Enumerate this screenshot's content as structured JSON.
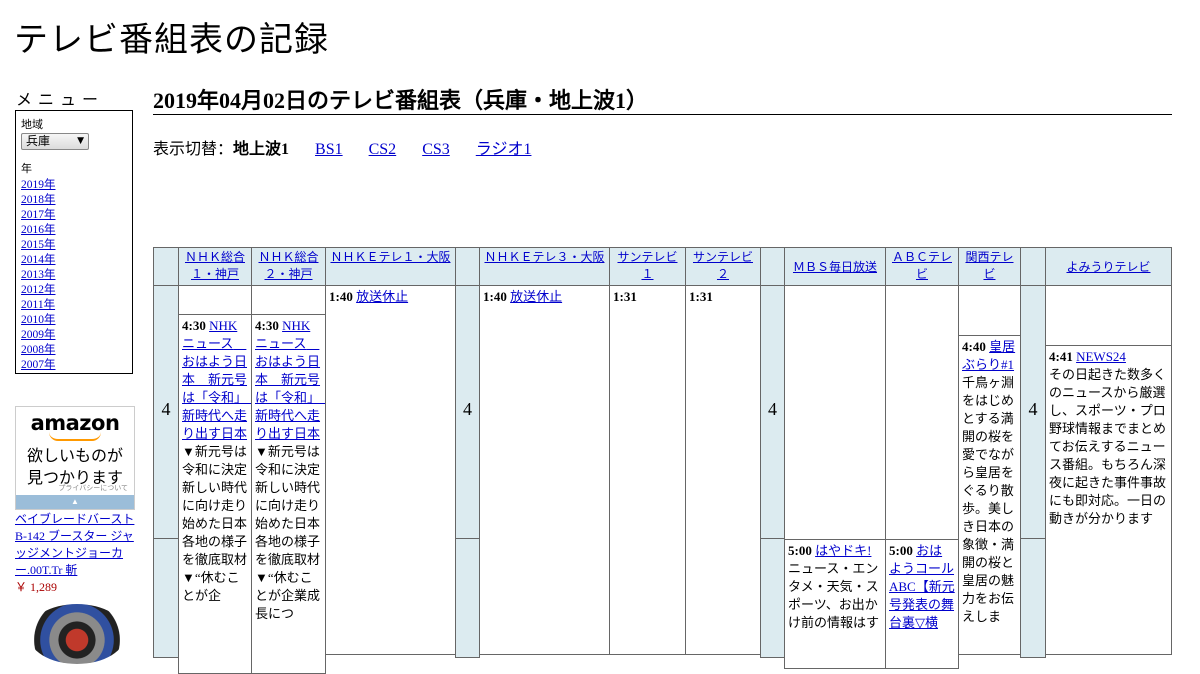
{
  "site": {
    "title": "テレビ番組表の記録"
  },
  "menu": {
    "heading": "メニュー",
    "region_label": "地域",
    "region_value": "兵庫",
    "year_label": "年",
    "years": [
      "2019年",
      "2018年",
      "2017年",
      "2016年",
      "2015年",
      "2014年",
      "2013年",
      "2012年",
      "2011年",
      "2010年",
      "2009年",
      "2008年",
      "2007年"
    ]
  },
  "ad": {
    "logo": "amazon",
    "line1": "欲しいものが",
    "line2": "見つかります",
    "privacy": "プライバシーについて",
    "product_name": "ベイブレードバースト B-142 ブースター ジャッジメントジョーカー.00T.Tr 斬",
    "product_price": "￥ 1,289"
  },
  "main": {
    "heading": "2019年04月02日のテレビ番組表（兵庫・地上波1）",
    "switch_label": "表示切替：",
    "switch_current": "地上波1",
    "switch_links": [
      "BS1",
      "CS2",
      "CS3",
      "ラジオ1"
    ]
  },
  "channels": [
    "ＮＨＫ総合１・神戸",
    "ＮＨＫ総合２・神戸",
    "ＮＨＫＥテレ１・大阪",
    "ＮＨＫＥテレ３・大阪",
    "サンテレビ１",
    "サンテレビ２",
    "ＭＢＳ毎日放送",
    "ＡＢＣテレビ",
    "関西テレビ",
    "よみうりテレビ"
  ],
  "hour": "4",
  "programs": {
    "nhk1": {
      "time": "4:30",
      "title": "NHKニュース　おはよう日本　新元号は「令和」　新時代へ走り出す日本",
      "desc": "▼新元号は令和に決定　新しい時代に向け走り始めた日本各地の様子を徹底取材▼“休むことが企"
    },
    "nhk2": {
      "time": "4:30",
      "title": "NHKニュース　おはよう日本　新元号は「令和」　新時代へ走り出す日本",
      "desc": "▼新元号は令和に決定　新しい時代に向け走り始めた日本各地の様子を徹底取材▼“休むことが企業成長につ"
    },
    "etv1": {
      "time": "1:40",
      "title": "放送休止"
    },
    "etv3": {
      "time": "1:40",
      "title": "放送休止"
    },
    "sun1": {
      "time": "1:31"
    },
    "sun2": {
      "time": "1:31"
    },
    "mbs": {
      "time": "5:00",
      "title": "はやドキ!",
      "desc": "ニュース・エンタメ・天気・スポーツ、お出かけ前の情報はす"
    },
    "abc": {
      "time": "5:00",
      "title": "おはようコールABC【新元号発表の舞台裏▽横"
    },
    "ktv": {
      "time": "4:40",
      "title": "皇居ぶらり#1",
      "desc": "千鳥ヶ淵をはじめとする満開の桜を愛でながら皇居をぐるり散歩。美しき日本の象徴・満開の桜と皇居の魅力をお伝えしま"
    },
    "ytv": {
      "time": "4:41",
      "title": "NEWS24",
      "desc": "その日起きた数多くのニュースから厳選し、スポーツ・プロ野球情報までまとめてお伝えするニュース番組。もちろん深夜に起きた事件事故にも即対応。一日の動きが分かります"
    }
  }
}
